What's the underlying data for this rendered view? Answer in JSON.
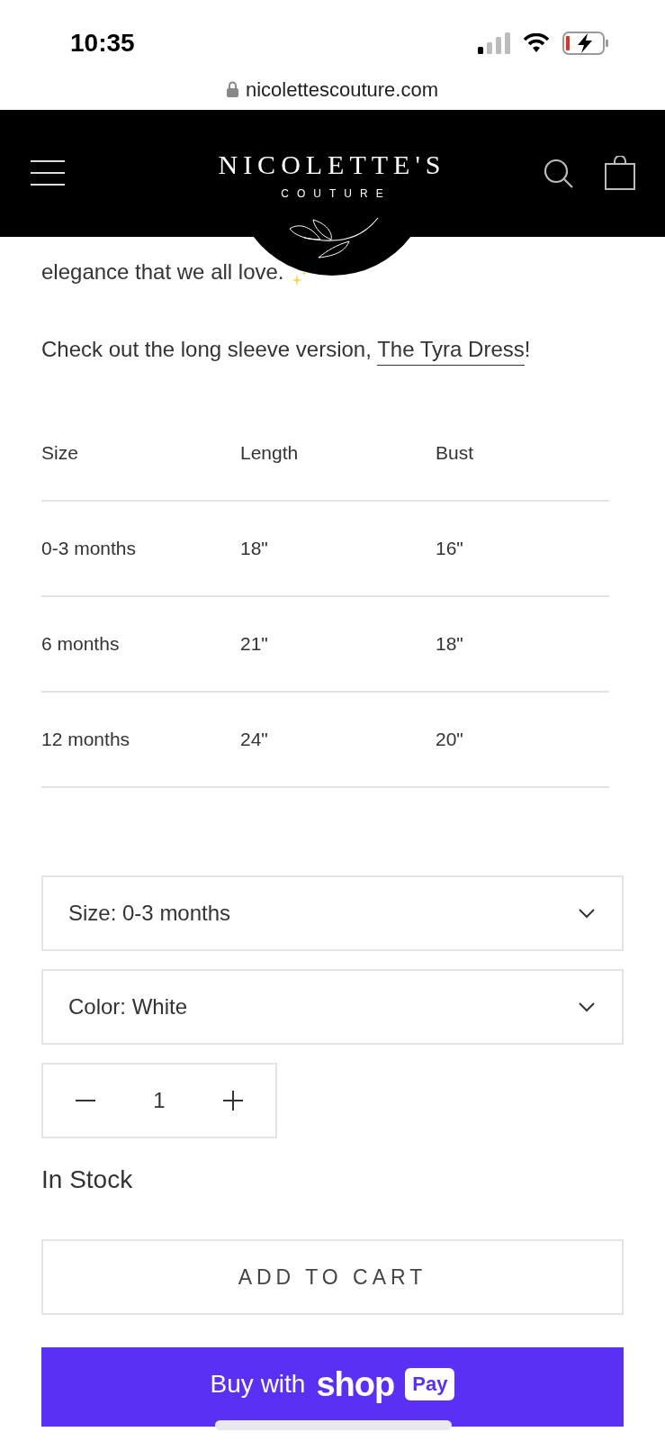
{
  "status_bar": {
    "time": "10:35"
  },
  "browser": {
    "url": "nicolettescouture.com"
  },
  "header": {
    "brand": "NICOLETTE'S",
    "brand_sub": "COUTURE"
  },
  "description": {
    "line": "elegance that we all love."
  },
  "cross_link": {
    "text": "Check out the long sleeve version, ",
    "link": "The Tyra Dress",
    "after": "!"
  },
  "size_table": {
    "columns": [
      "Size",
      "Length",
      "Bust"
    ],
    "rows": [
      [
        "0-3 months",
        "18\"",
        "16\""
      ],
      [
        "6 months",
        "21\"",
        "18\""
      ],
      [
        "12 months",
        "24\"",
        "20\""
      ]
    ]
  },
  "options": [
    {
      "label": "Size: 0-3 months"
    },
    {
      "label": "Color: White"
    }
  ],
  "quantity": {
    "value": "1"
  },
  "stock": "In Stock",
  "add_to_cart": "ADD TO CART",
  "shop_pay": {
    "prefix": "Buy with",
    "brand": "shop",
    "badge": "Pay"
  }
}
